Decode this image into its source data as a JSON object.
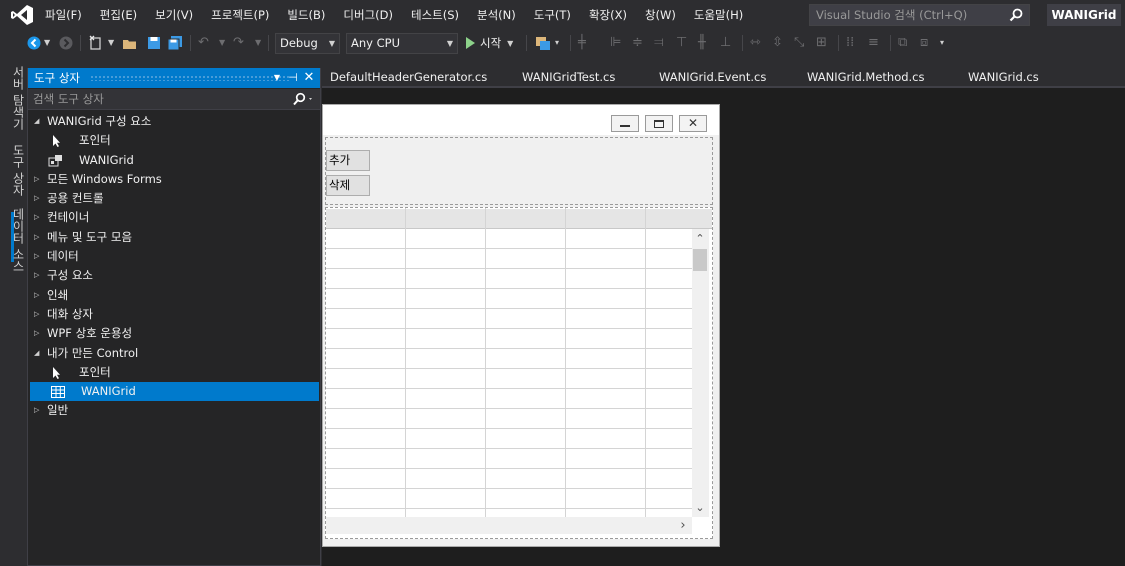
{
  "menu": {
    "items": [
      "파일(F)",
      "편집(E)",
      "보기(V)",
      "프로젝트(P)",
      "빌드(B)",
      "디버그(D)",
      "테스트(S)",
      "분석(N)",
      "도구(T)",
      "확장(X)",
      "창(W)",
      "도움말(H)"
    ]
  },
  "search": {
    "placeholder": "Visual Studio 검색 (Ctrl+Q)"
  },
  "solution": {
    "name": "WANIGrid"
  },
  "toolbar": {
    "configuration": "Debug",
    "platform": "Any CPU",
    "start_label": "시작"
  },
  "side_tabs": [
    "서버 탐색기",
    "도구 상자",
    "데이터 소스"
  ],
  "toolbox": {
    "title": "도구 상자",
    "search_placeholder": "검색 도구 상자",
    "rows": [
      {
        "kind": "group",
        "label": "WANIGrid 구성 요소",
        "expanded": true
      },
      {
        "kind": "item",
        "label": "포인터",
        "icon": "pointer-icon"
      },
      {
        "kind": "item",
        "label": "WANIGrid",
        "icon": "component-icon"
      },
      {
        "kind": "group",
        "label": "모든 Windows Forms",
        "expanded": false
      },
      {
        "kind": "group",
        "label": "공용 컨트롤",
        "expanded": false
      },
      {
        "kind": "group",
        "label": "컨테이너",
        "expanded": false
      },
      {
        "kind": "group",
        "label": "메뉴 및 도구 모음",
        "expanded": false
      },
      {
        "kind": "group",
        "label": "데이터",
        "expanded": false
      },
      {
        "kind": "group",
        "label": "구성 요소",
        "expanded": false
      },
      {
        "kind": "group",
        "label": "인쇄",
        "expanded": false
      },
      {
        "kind": "group",
        "label": "대화 상자",
        "expanded": false
      },
      {
        "kind": "group",
        "label": "WPF 상호 운용성",
        "expanded": false
      },
      {
        "kind": "group",
        "label": "내가 만든 Control",
        "expanded": true
      },
      {
        "kind": "item",
        "label": "포인터",
        "icon": "pointer-icon"
      },
      {
        "kind": "item",
        "label": "WANIGrid",
        "icon": "grid-icon",
        "selected": true
      },
      {
        "kind": "group",
        "label": "일반",
        "expanded": false
      }
    ]
  },
  "doc_tabs": [
    "DefaultHeaderGenerator.cs",
    "WANIGridTest.cs",
    "WANIGrid.Event.cs",
    "WANIGrid.Method.cs",
    "WANIGrid.cs"
  ],
  "form": {
    "buttons": [
      "추가",
      "삭제"
    ]
  },
  "colors": {
    "accent": "#007acc",
    "background": "#2d2d30",
    "panel": "#252526",
    "editor": "#1e1e1e"
  }
}
